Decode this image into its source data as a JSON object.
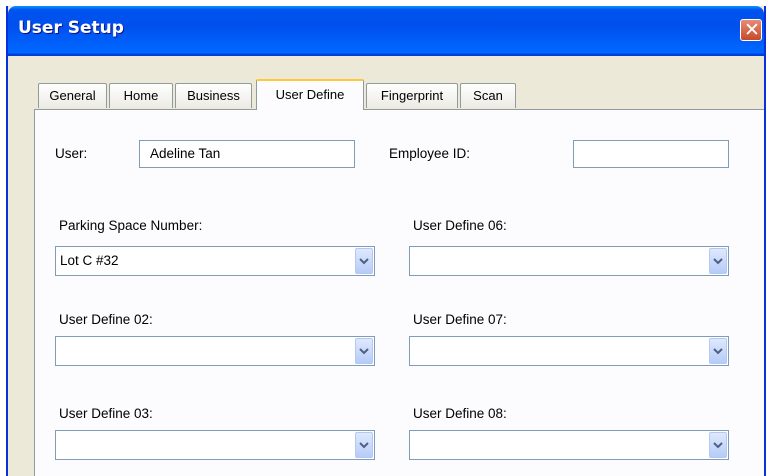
{
  "window": {
    "title": "User Setup",
    "close_glyph": "✕"
  },
  "tabs": [
    {
      "label": "General",
      "active": false
    },
    {
      "label": "Home",
      "active": false
    },
    {
      "label": "Business",
      "active": false
    },
    {
      "label": "User Define",
      "active": true
    },
    {
      "label": "Fingerprint",
      "active": false
    },
    {
      "label": "Scan",
      "active": false
    }
  ],
  "form": {
    "user_label": "User:",
    "user_value": "Adeline Tan",
    "employee_id_label": "Employee ID:",
    "employee_id_value": "",
    "fields": [
      {
        "label": "Parking Space Number:",
        "value": "Lot C #32"
      },
      {
        "label": "User Define 06:",
        "value": ""
      },
      {
        "label": "User Define 02:",
        "value": ""
      },
      {
        "label": "User Define 07:",
        "value": ""
      },
      {
        "label": "User Define 03:",
        "value": ""
      },
      {
        "label": "User Define 08:",
        "value": ""
      }
    ]
  },
  "icons": {
    "close": "close-icon",
    "dropdown": "chevron-down-icon"
  },
  "colors": {
    "titlebar": "#0054e3",
    "window_bg": "#ece9d8",
    "active_tab_highlight": "#ffc83c",
    "close_button": "#c44a2a"
  }
}
